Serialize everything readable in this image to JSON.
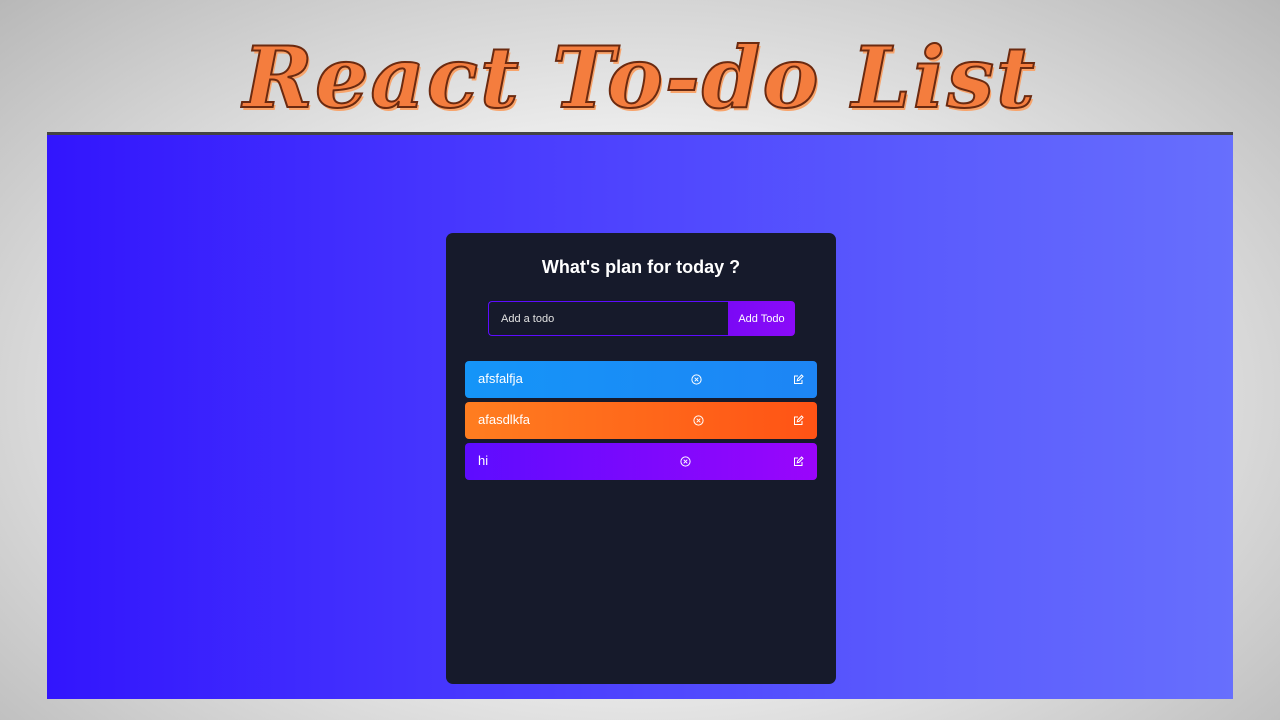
{
  "banner": {
    "title": "React To-do List"
  },
  "app": {
    "heading": "What's plan for today ?",
    "form": {
      "placeholder": "Add a todo",
      "value": "",
      "button_label": "Add Todo"
    },
    "todos": [
      {
        "text": "afsfalfja",
        "color": "#1595f8",
        "delete_icon": "close-circle-icon",
        "edit_icon": "edit-icon"
      },
      {
        "text": "afasdlkfa",
        "color": "#ff7d20",
        "delete_icon": "close-circle-icon",
        "edit_icon": "edit-icon"
      },
      {
        "text": "hi",
        "color": "#5d0cff",
        "delete_icon": "close-circle-icon",
        "edit_icon": "edit-icon"
      }
    ]
  },
  "colors": {
    "panel": "#161a2b",
    "frame_left": "#3215fd",
    "frame_right": "#676ffd",
    "banner_text": "#f47d3e",
    "banner_outline": "#6b2a10",
    "input_border": "#5d0cff",
    "button": "#7a09f5"
  }
}
